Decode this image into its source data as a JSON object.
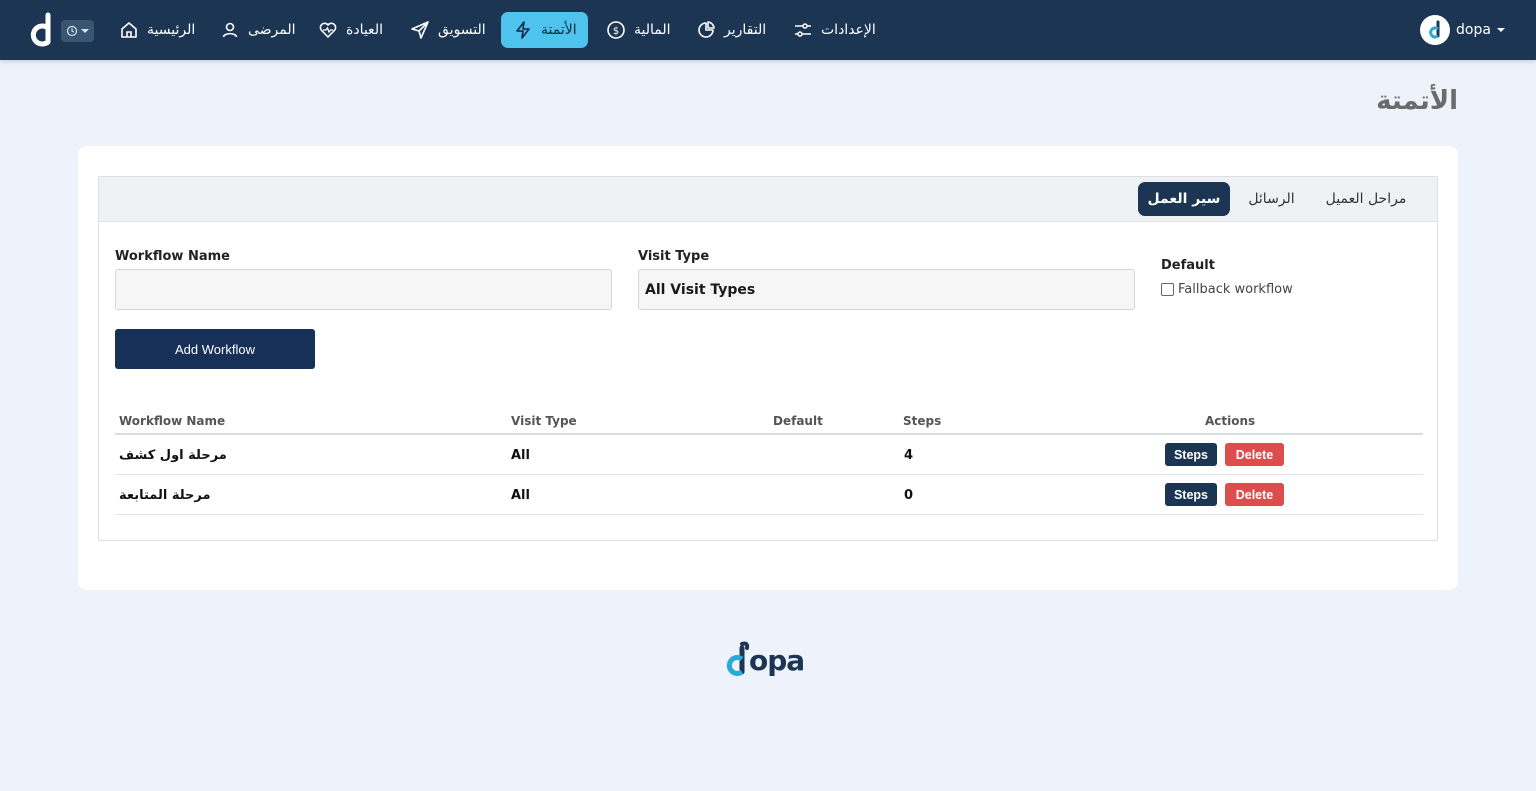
{
  "colors": {
    "navbar_bg": "#1b3553",
    "nav_active": "#4ec3ed",
    "accent_dark": "#163057",
    "danger": "#dc4e4e",
    "page_bg": "#eef2fa",
    "logo_cyan": "#2ba9d6"
  },
  "navbar": {
    "history_icon": "history-icon",
    "items": [
      {
        "label": "الرئيسية",
        "icon": "home-icon"
      },
      {
        "label": "المرضى",
        "icon": "user-icon"
      },
      {
        "label": "العيادة",
        "icon": "heart-pulse-icon"
      },
      {
        "label": "التسويق",
        "icon": "send-icon"
      },
      {
        "label": "الأتمتة",
        "icon": "bolt-icon",
        "active": true
      },
      {
        "label": "المالية",
        "icon": "dollar-icon"
      },
      {
        "label": "التقارير",
        "icon": "pie-chart-icon"
      },
      {
        "label": "الإعدادات",
        "icon": "sliders-icon"
      }
    ],
    "user": {
      "name": "dopa",
      "icon": "dopa-logo-icon"
    }
  },
  "page": {
    "title": "الأتمتة"
  },
  "tabs": [
    {
      "label": "سير العمل",
      "active": true
    },
    {
      "label": "الرسائل",
      "active": false
    },
    {
      "label": "مراحل العميل",
      "active": false
    }
  ],
  "form": {
    "workflow_name_label": "Workflow Name",
    "workflow_name_value": "",
    "visit_type_label": "Visit Type",
    "visit_type_value": "All Visit Types",
    "default_label": "Default",
    "fallback_label": "Fallback workflow",
    "fallback_checked": false,
    "add_button": "Add Workflow"
  },
  "table": {
    "headers": [
      "Workflow Name",
      "Visit Type",
      "Default",
      "Steps",
      "Actions"
    ],
    "rows": [
      {
        "name": "مرحلة اول كشف",
        "visit_type": "All",
        "default": "",
        "steps": "4",
        "steps_btn": "Steps",
        "delete_btn": "Delete"
      },
      {
        "name": "مرحلة المتابعة",
        "visit_type": "All",
        "default": "",
        "steps": "0",
        "steps_btn": "Steps",
        "delete_btn": "Delete"
      }
    ]
  },
  "footer": {
    "logo_text": "opa"
  }
}
